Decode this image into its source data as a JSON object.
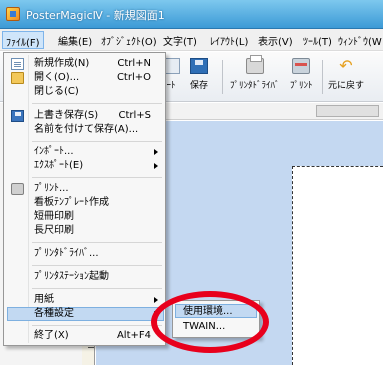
{
  "window": {
    "title": "PosterMagicⅣ - 新規図面1"
  },
  "menubar": {
    "items": [
      {
        "label": "ﾌｧｲﾙ(F)"
      },
      {
        "label": "編集(E)"
      },
      {
        "label": "ｵﾌﾞｼﾞｪｸﾄ(O)"
      },
      {
        "label": "文字(T)"
      },
      {
        "label": "ﾚｲｱｳﾄ(L)"
      },
      {
        "label": "表示(V)"
      },
      {
        "label": "ﾂｰﾙ(T)"
      },
      {
        "label": "ｳｨﾝﾄﾞｳ(W"
      }
    ]
  },
  "toolbar": {
    "items": [
      {
        "label": "ｰﾄ"
      },
      {
        "label": "保存"
      },
      {
        "label": "ﾌﾟﾘﾝﾀﾄﾞﾗｲﾊﾞ"
      },
      {
        "label": "ﾌﾟﾘﾝﾄ"
      },
      {
        "label": "元に戻す"
      }
    ]
  },
  "file_menu": {
    "items": [
      {
        "label": "新規作成(N)",
        "shortcut": "Ctrl+N"
      },
      {
        "label": "開く(O)...",
        "shortcut": "Ctrl+O"
      },
      {
        "label": "閉じる(C)",
        "shortcut": ""
      },
      {
        "label": "上書き保存(S)",
        "shortcut": "Ctrl+S"
      },
      {
        "label": "名前を付けて保存(A)...",
        "shortcut": ""
      },
      {
        "label": "ｲﾝﾎﾟｰﾄ...",
        "shortcut": ""
      },
      {
        "label": "ｴｸｽﾎﾟｰﾄ(E)",
        "shortcut": ""
      },
      {
        "label": "ﾌﾟﾘﾝﾄ...",
        "shortcut": ""
      },
      {
        "label": "看板ﾃﾝﾌﾟﾚｰﾄ作成",
        "shortcut": ""
      },
      {
        "label": "短冊印刷",
        "shortcut": ""
      },
      {
        "label": "長尺印刷",
        "shortcut": ""
      },
      {
        "label": "ﾌﾟﾘﾝﾀﾄﾞﾗｲﾊﾞ...",
        "shortcut": ""
      },
      {
        "label": "ﾌﾟﾘﾝﾀｽﾃｰｼｮﾝ起動",
        "shortcut": ""
      },
      {
        "label": "用紙",
        "shortcut": ""
      },
      {
        "label": "各種設定",
        "shortcut": ""
      },
      {
        "label": "終了(X)",
        "shortcut": "Alt+F4"
      }
    ]
  },
  "submenu": {
    "items": [
      {
        "label": "使用環境..."
      },
      {
        "label": "TWAIN..."
      }
    ]
  },
  "colors": {
    "highlight": "#c2d9f2",
    "annotation_ring": "#e8001c",
    "canvas": "#c4d8f1"
  }
}
